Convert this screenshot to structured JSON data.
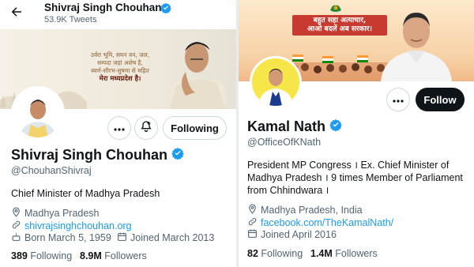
{
  "left_profile": {
    "header": {
      "name": "Shivraj Singh Chouhan",
      "tweet_count": "53.9K Tweets"
    },
    "banner": {
      "poem_lines": [
        "उर्वरा भूमि, सघन वन, जल,",
        "सम्पदा जहां अशेष है,",
        "स्वर्ण-सौरभ-सुषमा से महित",
        "मेरा मध्यप्रदेश है।"
      ]
    },
    "actions": {
      "following_label": "Following"
    },
    "name": "Shivraj Singh Chouhan",
    "handle": "@ChouhanShivraj",
    "bio": "Chief Minister of Madhya Pradesh",
    "location": "Madhya Pradesh",
    "website": "shivrajsinghchouhan.org",
    "born": "Born March 5, 1959",
    "joined": "Joined March 2013",
    "following_count": "389",
    "following_label": "Following",
    "followers_count": "8.9M",
    "followers_label": "Followers"
  },
  "right_profile": {
    "banner": {
      "slogan_line1": "बहुत सहा अत्याचार,",
      "slogan_line2": "आओ बदलें अब सरकार।"
    },
    "actions": {
      "follow_label": "Follow"
    },
    "name": "Kamal Nath",
    "handle": "@OfficeOfKNath",
    "bio": "President MP Congress । Ex. Chief Minister of Madhya Pradesh । 9 times Member of Parliament from Chhindwara ।",
    "location": "Madhya Pradesh, India",
    "website": "facebook.com/TheKamalNath/",
    "joined": "Joined April 2016",
    "following_count": "82",
    "following_label": "Following",
    "followers_count": "1.4M",
    "followers_label": "Followers"
  },
  "colors": {
    "accent": "#1d9bf0",
    "text_primary": "#0f1419",
    "text_secondary": "#536471",
    "verified": "#1d9bf0",
    "follow_button_bg": "#0f1419"
  },
  "icons": [
    "back-arrow-icon",
    "verified-badge-icon",
    "more-icon",
    "notification-bell-icon",
    "location-pin-icon",
    "link-icon",
    "birthday-icon",
    "calendar-icon"
  ]
}
